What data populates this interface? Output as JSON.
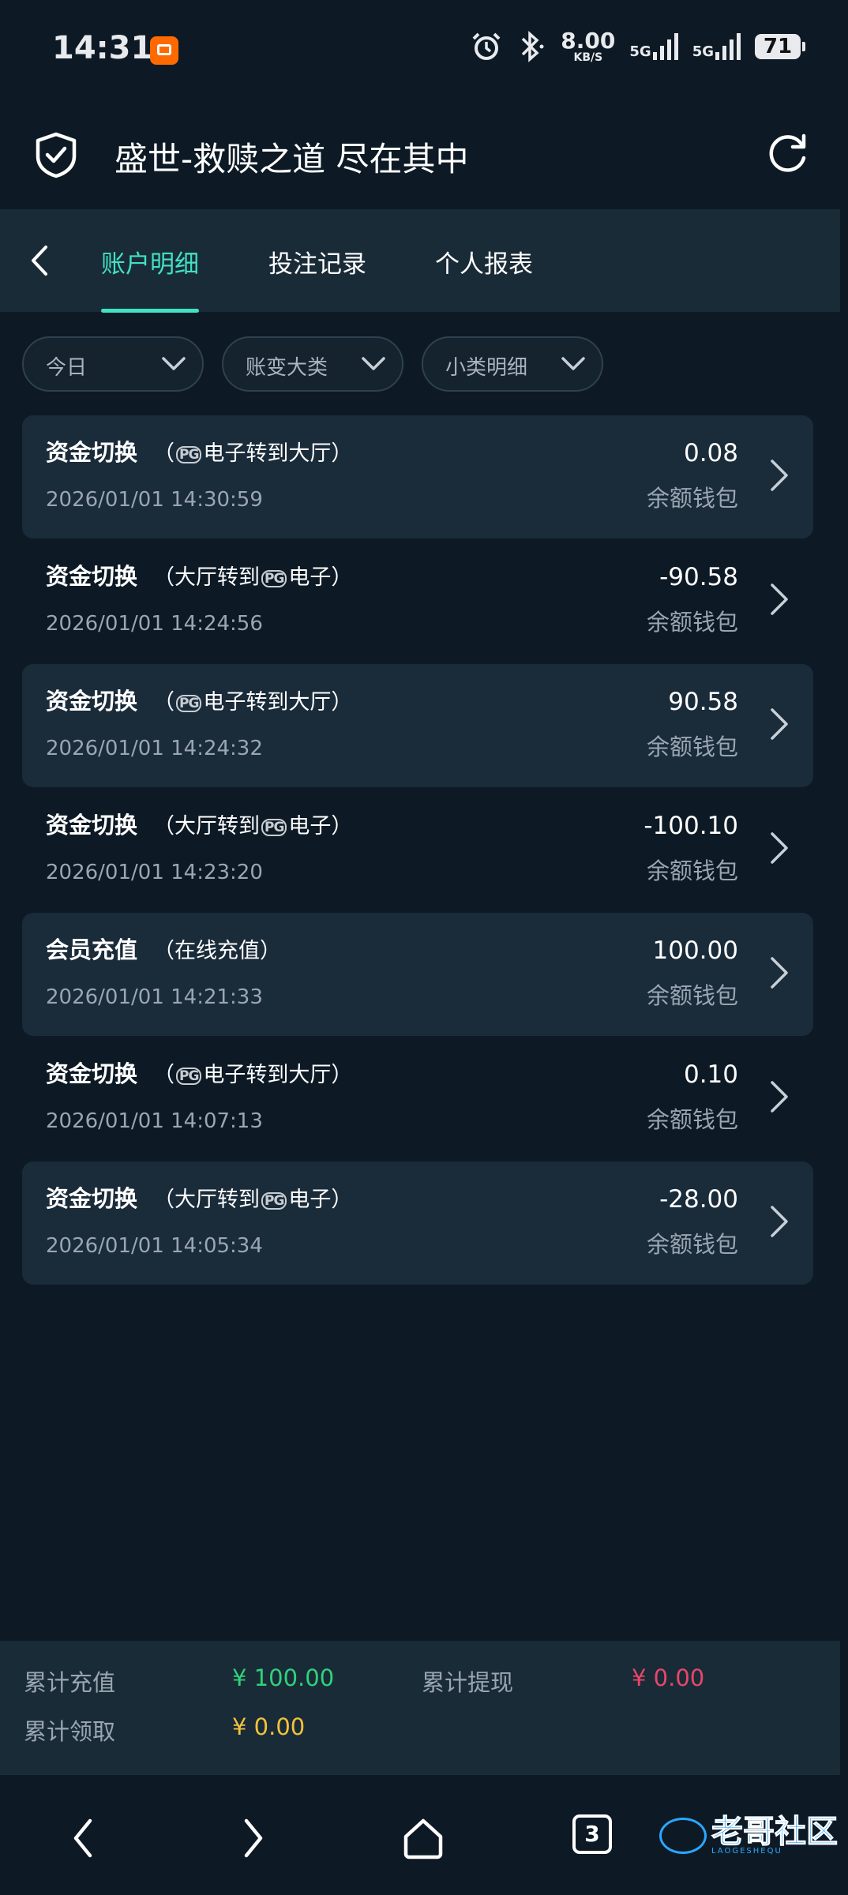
{
  "status_bar": {
    "time": "14:31",
    "speed_value": "8.00",
    "speed_unit": "KB/S",
    "net1": "5G",
    "net2": "5G",
    "battery": "71"
  },
  "header": {
    "title": "盛世-救赎之道 尽在其中"
  },
  "tabs": [
    {
      "label": "账户明细"
    },
    {
      "label": "投注记录"
    },
    {
      "label": "个人报表"
    }
  ],
  "filters": [
    {
      "label": "今日"
    },
    {
      "label": "账变大类"
    },
    {
      "label": "小类明细"
    }
  ],
  "icons": {
    "pg_logo": "PG"
  },
  "transactions": [
    {
      "title": "资金切换",
      "sub_pre": "（",
      "sub_post": "电子转到大厅）",
      "date": "2026/01/01 14:30:59",
      "amount": "0.08",
      "wallet": "余额钱包"
    },
    {
      "title": "资金切换",
      "sub_pre": "（大厅转到",
      "sub_post": "电子）",
      "date": "2026/01/01 14:24:56",
      "amount": "-90.58",
      "wallet": "余额钱包"
    },
    {
      "title": "资金切换",
      "sub_pre": "（",
      "sub_post": "电子转到大厅）",
      "date": "2026/01/01 14:24:32",
      "amount": "90.58",
      "wallet": "余额钱包"
    },
    {
      "title": "资金切换",
      "sub_pre": "（大厅转到",
      "sub_post": "电子）",
      "date": "2026/01/01 14:23:20",
      "amount": "-100.10",
      "wallet": "余额钱包"
    },
    {
      "title": "会员充值",
      "sub_pre": "（在线充值）",
      "sub_post": "",
      "date": "2026/01/01 14:21:33",
      "amount": "100.00",
      "wallet": "余额钱包"
    },
    {
      "title": "资金切换",
      "sub_pre": "（",
      "sub_post": "电子转到大厅）",
      "date": "2026/01/01 14:07:13",
      "amount": "0.10",
      "wallet": "余额钱包"
    },
    {
      "title": "资金切换",
      "sub_pre": "（大厅转到",
      "sub_post": "电子）",
      "date": "2026/01/01 14:05:34",
      "amount": "-28.00",
      "wallet": "余额钱包"
    }
  ],
  "summary": {
    "recharge_label": "累计充值",
    "recharge_value": "¥ 100.00",
    "recharge_color": "#2fd27a",
    "withdraw_label": "累计提现",
    "withdraw_value": "¥ 0.00",
    "withdraw_color": "#e8466a",
    "claim_label": "累计领取",
    "claim_value": "¥ 0.00",
    "claim_color": "#f2c23c"
  },
  "navbar": {
    "tab_count": "3"
  },
  "watermark": {
    "text": "老哥社区",
    "sub": "LAOGESHEQU"
  },
  "colors": {
    "accent": "#41e1c1",
    "background": "#0d1a25",
    "card": "#1a2b3a"
  }
}
